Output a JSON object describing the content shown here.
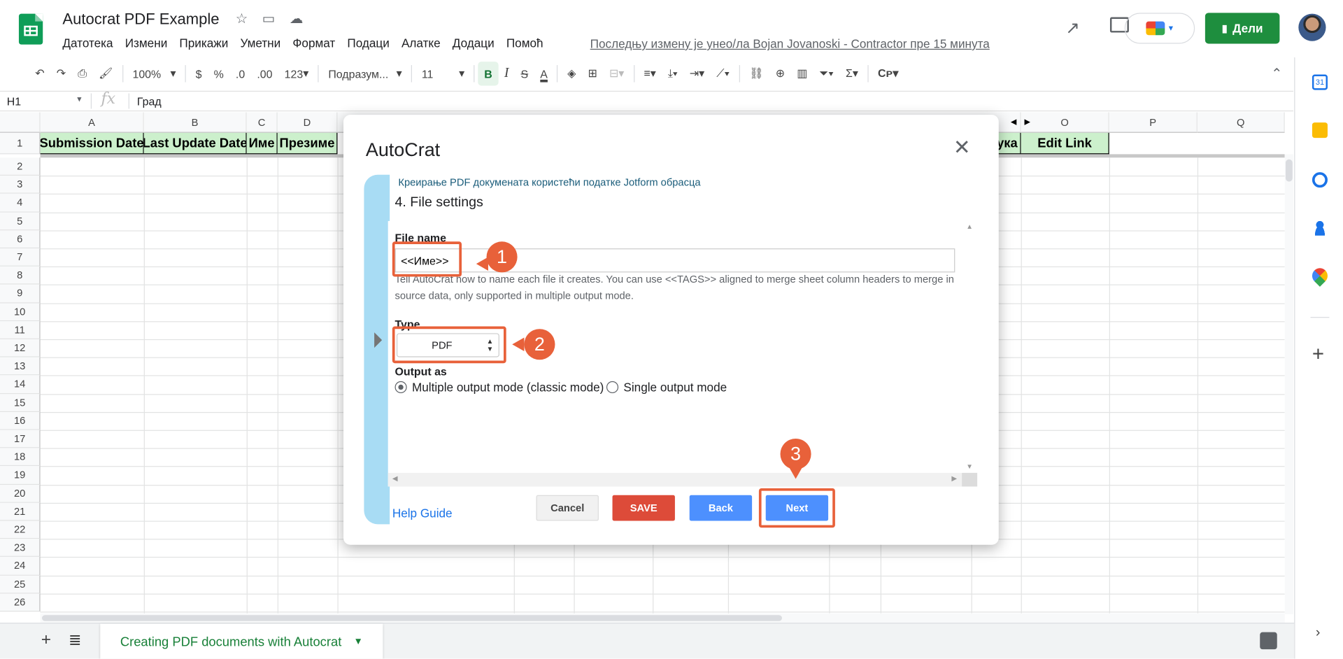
{
  "header": {
    "doc_title": "Autocrat PDF Example",
    "menu": [
      "Датотека",
      "Измени",
      "Прикажи",
      "Уметни",
      "Формат",
      "Подаци",
      "Алатке",
      "Додаци",
      "Помоћ"
    ],
    "last_edit": "Последњу измену је унео/ла Bojan Jovanoski - Contractor пре 15 минута",
    "share_label": "Дели"
  },
  "toolbar": {
    "zoom": "100%",
    "currency": "$",
    "percent": "%",
    "dec_less": ".0",
    "dec_more": ".00",
    "format_num": "123",
    "font": "Подразум...",
    "font_size": "11",
    "bold": "B",
    "italic": "I",
    "strike": "S",
    "text_color": "A"
  },
  "formula": {
    "cell": "H1",
    "fx": "fx",
    "value": "Град"
  },
  "grid": {
    "columns": [
      "A",
      "B",
      "C",
      "D",
      "O",
      "P",
      "Q"
    ],
    "header_cells": [
      "Submission Date",
      "Last Update Date",
      "Име",
      "Презиме",
      "ука",
      "Edit Link"
    ],
    "rows": [
      "1",
      "2",
      "3",
      "4",
      "5",
      "6",
      "7",
      "8",
      "9",
      "10",
      "11",
      "12",
      "13",
      "14",
      "15",
      "16",
      "17",
      "18",
      "19",
      "20",
      "21",
      "22",
      "23",
      "24",
      "25",
      "26"
    ]
  },
  "sheet_tab": "Creating PDF documents with Autocrat",
  "dialog": {
    "title": "AutoCrat",
    "breadcrumb": "Креирање PDF докумената користећи податке Jotform обрасца",
    "step": "4. File settings",
    "file_name_label": "File name",
    "file_name_value": "<<Име>>",
    "file_name_hint": "Tell AutoCrat how to name each file it creates. You can use <<TAGS>> aligned to merge sheet column headers to merge in source data, only supported in multiple output mode.",
    "type_label": "Type",
    "type_value": "PDF",
    "output_label": "Output as",
    "output_multiple": "Multiple output mode (classic mode)",
    "output_single": "Single output mode",
    "help": "Help Guide",
    "cancel": "Cancel",
    "save": "SAVE",
    "back": "Back",
    "next": "Next"
  },
  "callouts": [
    "1",
    "2",
    "3"
  ],
  "colors": {
    "accent_green": "#1e8e3e",
    "save_red": "#dd4b39",
    "primary_blue": "#4d90fe",
    "highlight": "#e8613a"
  }
}
